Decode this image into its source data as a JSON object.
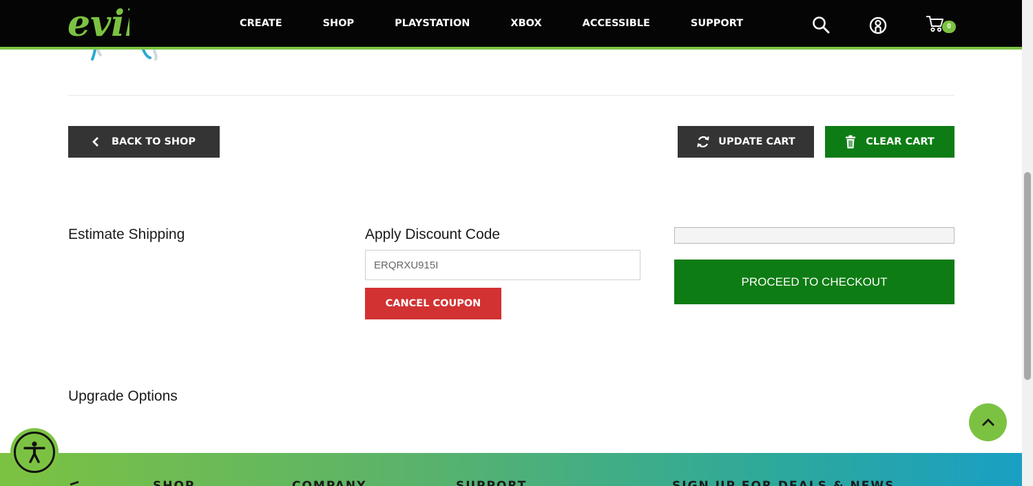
{
  "header": {
    "logo_text": "evil",
    "nav": [
      "CREATE",
      "SHOP",
      "PLAYSTATION",
      "XBOX",
      "ACCESSIBLE",
      "SUPPORT"
    ],
    "cart_count": "0"
  },
  "cart_actions": {
    "back_label": "BACK TO SHOP",
    "update_label": "UPDATE CART",
    "clear_label": "CLEAR CART"
  },
  "shipping": {
    "title": "Estimate Shipping"
  },
  "discount": {
    "title": "Apply Discount Code",
    "code_value": "ERQRXU915I",
    "cancel_label": "CANCEL COUPON"
  },
  "checkout": {
    "proceed_label": "PROCEED TO CHECKOUT"
  },
  "upgrade": {
    "title": "Upgrade Options"
  },
  "footer": {
    "columns": [
      "SHOP",
      "COMPANY",
      "SUPPORT",
      "SIGN UP FOR DEALS & NEWS"
    ]
  },
  "colors": {
    "brand_green": "#7cc242",
    "dark_green": "#0e7c14",
    "dark_button": "#343434",
    "danger_red": "#d23232"
  }
}
